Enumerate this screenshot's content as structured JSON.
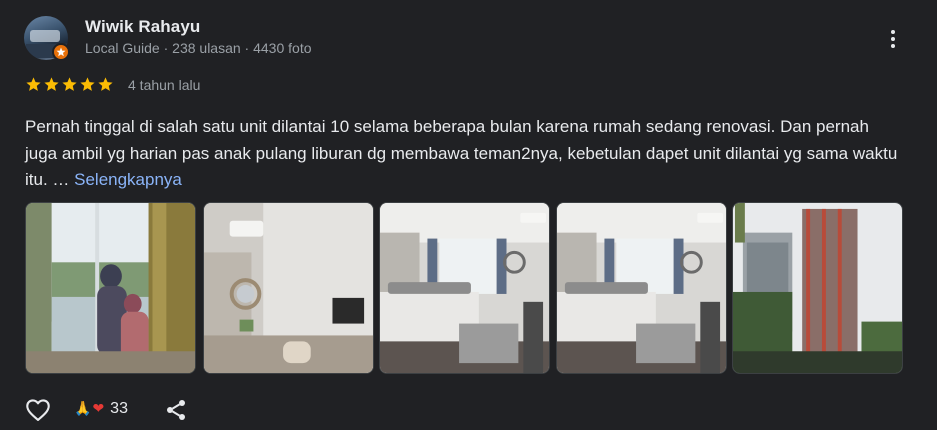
{
  "reviewer": {
    "name": "Wiwik Rahayu",
    "meta": "Local Guide · 238 ulasan · 4430 foto"
  },
  "rating": {
    "stars": 5,
    "max": 5,
    "color": "#fbbc04"
  },
  "time_ago": "4 tahun lalu",
  "review": {
    "text": "Pernah tinggal di salah satu unit dilantai 10 selama beberapa bulan karena rumah sedang renovasi. Dan pernah juga ambil yg harian pas anak pulang liburan dg membawa teman2nya, kebetulan dapet unit dilantai yg sama waktu itu. … ",
    "more_label": "Selengkapnya"
  },
  "photos": [
    {
      "icon": "window-view-photo"
    },
    {
      "icon": "room-wall-tv-photo"
    },
    {
      "icon": "bedroom-photo"
    },
    {
      "icon": "bedroom-photo"
    },
    {
      "icon": "building-exterior-photo"
    }
  ],
  "actions": {
    "like_icon": "heart-outline-icon",
    "reactions": [
      "🙏",
      "❤"
    ],
    "reaction_count": "33",
    "share_icon": "share-icon"
  },
  "colors": {
    "background": "#202124",
    "text": "#e8eaed",
    "secondary": "#9aa0a6",
    "link": "#8ab4f8",
    "star": "#fbbc04",
    "badge": "#e8710a"
  }
}
